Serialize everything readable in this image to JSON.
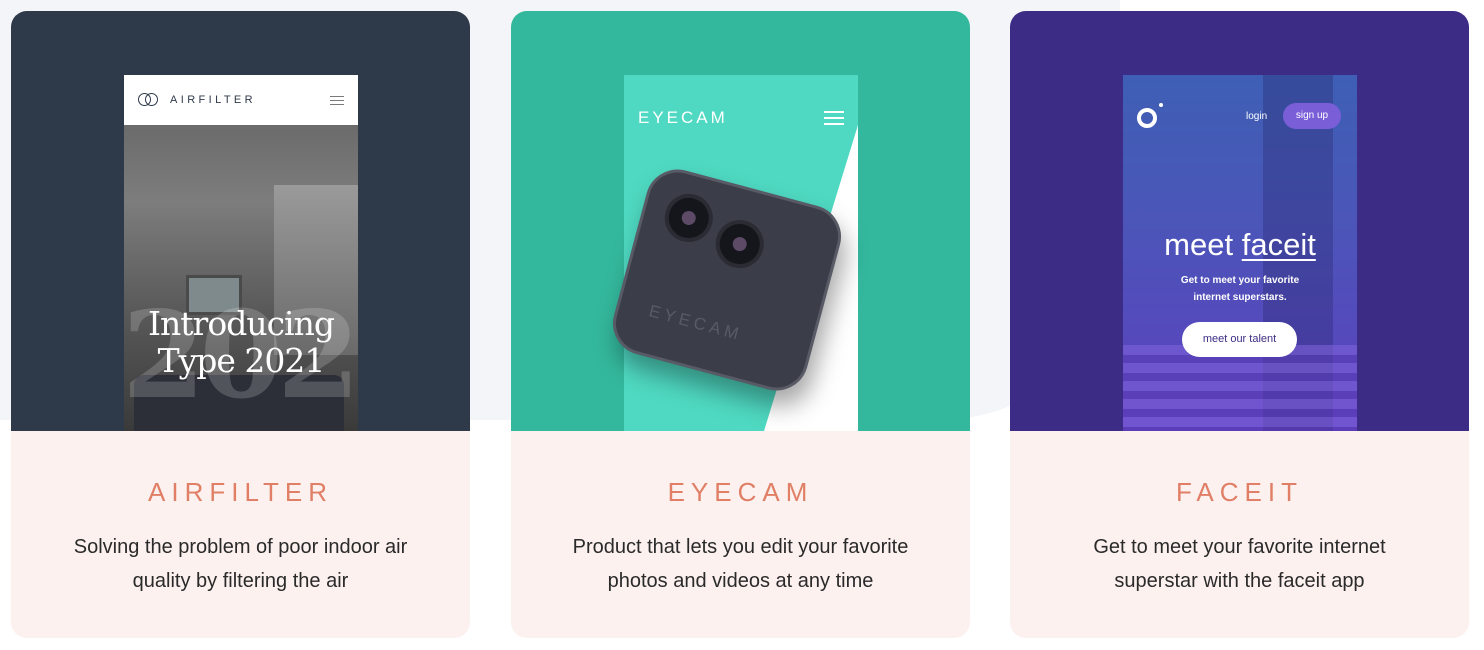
{
  "cards": [
    {
      "title": "AIRFILTER",
      "description": "Solving the problem of poor indoor air quality by filtering the air",
      "mockup": {
        "brand": "AIRFILTER",
        "headline_line1": "Introducing",
        "headline_line2": "Type 2021",
        "watermark": "2021",
        "nav_icon": "hamburger-icon",
        "logo_icon": "interlocking-rings-icon"
      },
      "colors": {
        "top": "#2e3949",
        "accent": "#e07f66"
      }
    },
    {
      "title": "EYECAM",
      "description": "Product that lets you edit your favorite photos and videos at any time",
      "mockup": {
        "brand": "EYECAM",
        "camera_label": "EYECAM",
        "nav_icon": "hamburger-icon"
      },
      "colors": {
        "top": "#34b89d",
        "accent": "#e07f66"
      }
    },
    {
      "title": "FACEIT",
      "description": "Get to meet your favorite internet superstar with the faceit app",
      "mockup": {
        "login": "login",
        "signup": "sign up",
        "headline_pre": "meet",
        "headline_brand": "faceit",
        "subtext": "Get to meet your favorite internet superstars.",
        "cta": "meet our talent",
        "logo_icon": "ring-logo-icon"
      },
      "colors": {
        "top": "#3d2c85",
        "accent": "#e07f66"
      }
    }
  ]
}
